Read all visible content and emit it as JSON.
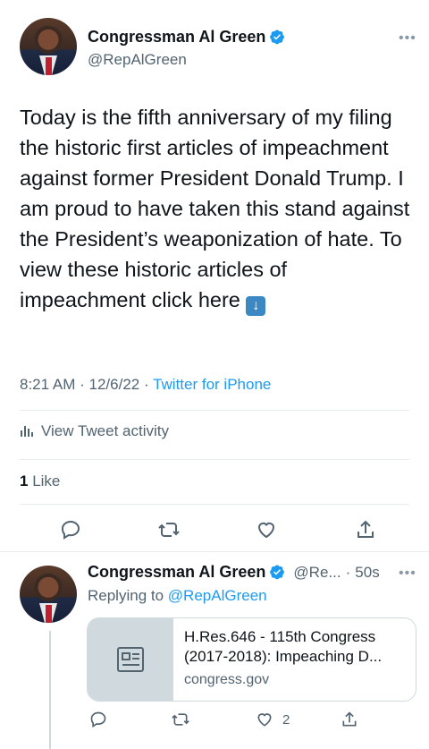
{
  "tweet": {
    "author_name": "Congressman Al Green",
    "author_handle": "@RepAlGreen",
    "text": "Today is the fifth anniversary of my filing the historic first articles of impeachment against former President Donald Trump. I am proud to have taken this stand against the President’s weaponization of hate. To view these historic articles of impeachment click here",
    "emoji_icon": "down-arrow-icon",
    "time": "8:21 AM",
    "date": "12/6/22",
    "separator": "·",
    "source": "Twitter for iPhone",
    "activity_label": "View Tweet activity",
    "like_count": "1",
    "like_label": "Like"
  },
  "reply": {
    "author_name": "Congressman Al Green",
    "author_handle": "@Re...",
    "time_ago": "50s",
    "replying_prefix": "Replying to",
    "replying_handle": "@RepAlGreen",
    "card": {
      "title": "H.Res.646 - 115th Congress (2017-2018): Impeaching D...",
      "domain": "congress.gov"
    },
    "like_count": "2"
  },
  "colors": {
    "accent": "#1d9bf0",
    "text_primary": "#0f1419",
    "text_secondary": "#536471"
  }
}
